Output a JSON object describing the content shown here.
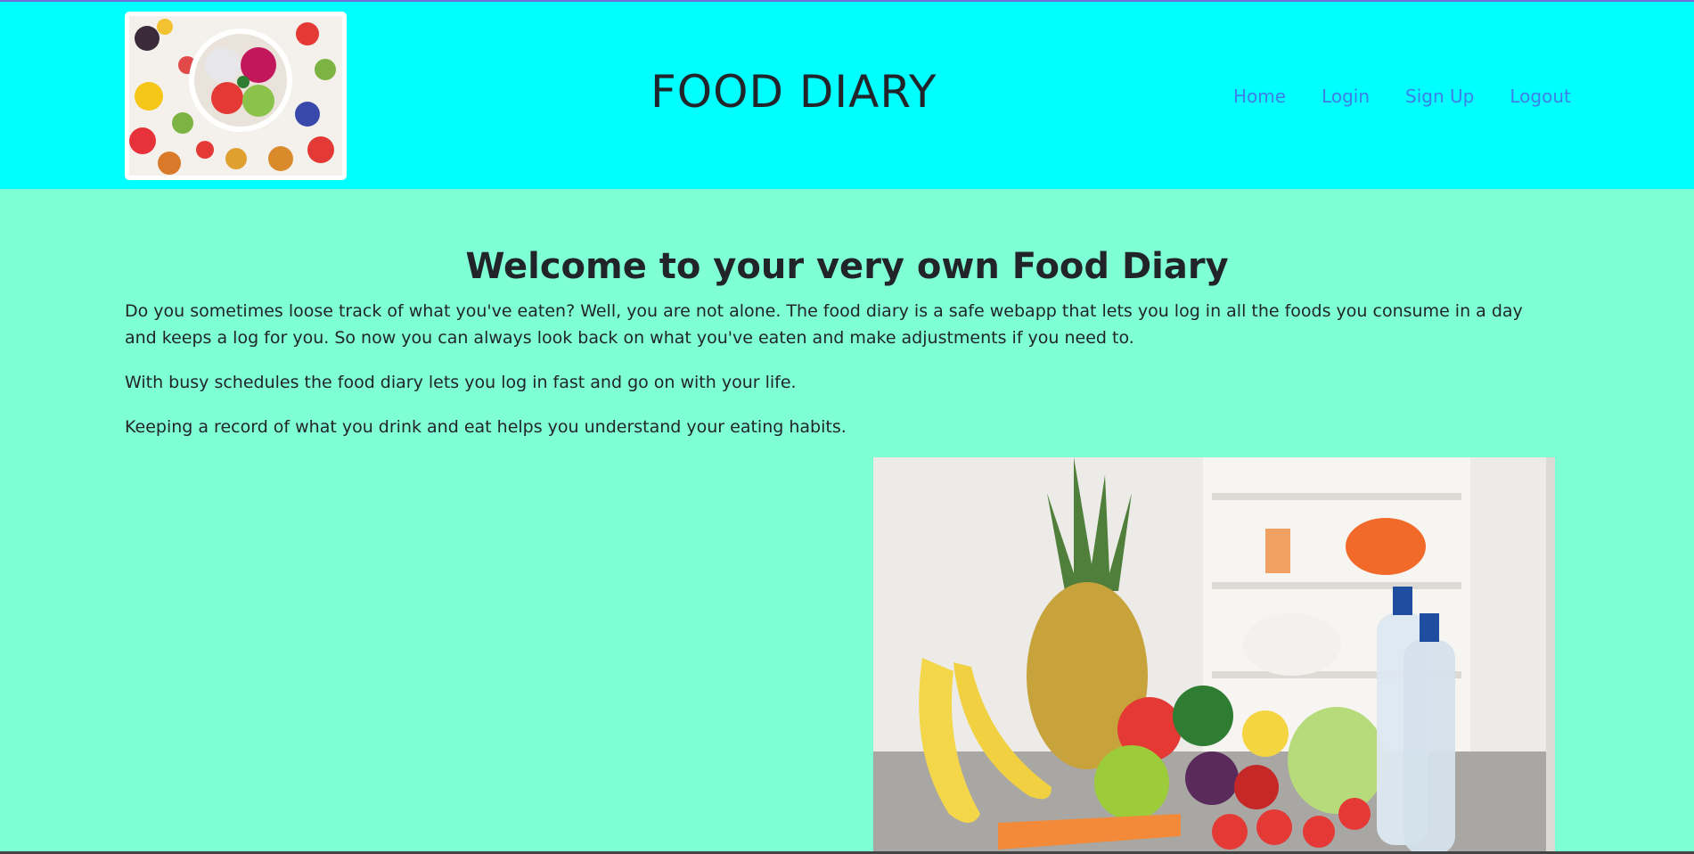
{
  "header": {
    "brand": "FOOD DIARY",
    "logo_image": "fruit-bowl-photo",
    "nav": {
      "home": "Home",
      "login": "Login",
      "signup": "Sign Up",
      "logout": "Logout"
    }
  },
  "main": {
    "heading": "Welcome to your very own Food Diary",
    "paragraphs": [
      "Do you sometimes loose track of what you've eaten? Well, you are not alone. The food diary is a safe webapp that lets you log in all the foods you consume in a day and keeps a log for you. So now you can always look back on what you've eaten and make adjustments if you need to.",
      "With busy schedules the food diary lets you log in fast and go on with your life.",
      "Keeping a record of what you drink and eat helps you understand your eating habits."
    ],
    "hero_image": "fruits-vegetables-water-bottles-photo"
  },
  "colors": {
    "header_bg": "#00ffff",
    "page_bg": "#7fffd4",
    "link": "#3d7fe8",
    "text": "#212529"
  }
}
